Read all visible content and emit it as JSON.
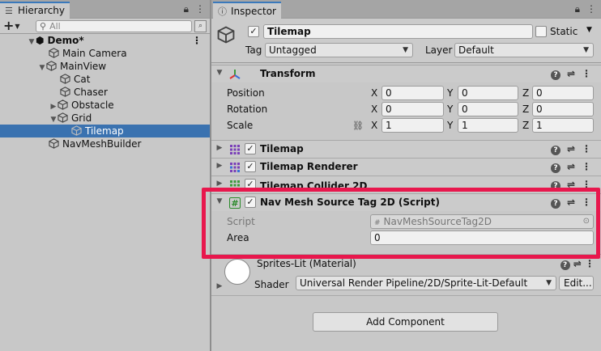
{
  "hierarchy": {
    "tab_label": "Hierarchy",
    "search_placeholder": "All",
    "scene": "Demo*",
    "items": [
      {
        "label": "Main Camera"
      },
      {
        "label": "MainView"
      },
      {
        "label": "Cat"
      },
      {
        "label": "Chaser"
      },
      {
        "label": "Obstacle"
      },
      {
        "label": "Grid"
      },
      {
        "label": "Tilemap"
      },
      {
        "label": "NavMeshBuilder"
      }
    ]
  },
  "inspector": {
    "tab_label": "Inspector",
    "object_name": "Tilemap",
    "active_checked": true,
    "static_label": "Static",
    "tag_label": "Tag",
    "tag_value": "Untagged",
    "layer_label": "Layer",
    "layer_value": "Default",
    "transform": {
      "title": "Transform",
      "position_label": "Position",
      "rotation_label": "Rotation",
      "scale_label": "Scale",
      "x": "X",
      "y": "Y",
      "z": "Z",
      "position": [
        "0",
        "0",
        "0"
      ],
      "rotation": [
        "0",
        "0",
        "0"
      ],
      "scale": [
        "1",
        "1",
        "1"
      ]
    },
    "components": [
      {
        "title": "Tilemap"
      },
      {
        "title": "Tilemap Renderer"
      },
      {
        "title": "Tilemap Collider 2D"
      }
    ],
    "navmesh": {
      "title": "Nav Mesh Source Tag 2D (Script)",
      "script_label": "Script",
      "script_value": "NavMeshSourceTag2D",
      "area_label": "Area",
      "area_value": "0"
    },
    "material": {
      "title": "Sprites-Lit (Material)",
      "shader_label": "Shader",
      "shader_value": "Universal Render Pipeline/2D/Sprite-Lit-Default",
      "edit_label": "Edit..."
    },
    "add_component": "Add Component"
  },
  "colors": {
    "selection": "#3a72b0",
    "highlight": "#e8174d"
  }
}
